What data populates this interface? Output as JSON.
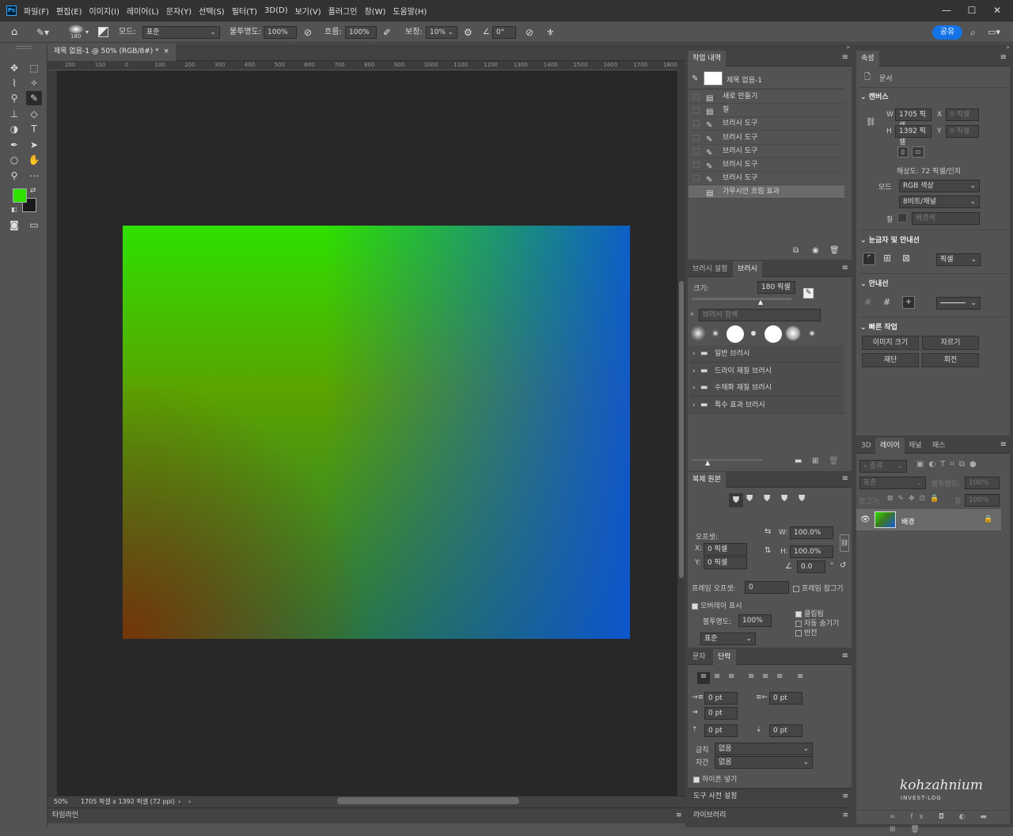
{
  "app": {
    "logo": "Ps"
  },
  "menu": [
    "파일(F)",
    "편집(E)",
    "이미지(I)",
    "레이어(L)",
    "문자(Y)",
    "선택(S)",
    "필터(T)",
    "3D(D)",
    "보기(V)",
    "플러그인",
    "창(W)",
    "도움말(H)"
  ],
  "window_controls": {
    "minimize": "—",
    "maximize": "☐",
    "close": "✕"
  },
  "options": {
    "brush_size": "180",
    "mode_label": "모드:",
    "mode_value": "표준",
    "opacity_label": "불투명도:",
    "opacity_value": "100%",
    "flow_label": "흐름:",
    "flow_value": "100%",
    "smoothing_label": "보정:",
    "smoothing_value": "10%",
    "angle_value": "0°",
    "share_label": "공유"
  },
  "document": {
    "tab_title": "제목 없음-1 @ 50% (RGB/8#) *",
    "zoom": "50%",
    "info": "1705 픽셀 x 1392 픽셀 (72 ppi)",
    "ruler_h": [
      "200",
      "100",
      "0",
      "100",
      "200",
      "300",
      "400",
      "500",
      "600",
      "700",
      "800",
      "900",
      "1000",
      "1100",
      "1200",
      "1300",
      "1400",
      "1500",
      "1600",
      "1700",
      "1800"
    ]
  },
  "timeline_label": "타임라인",
  "colors": {
    "foreground": "#2ee000",
    "background": "#1a1a1a",
    "accent": "#1473e6"
  },
  "history": {
    "tab": "작업 내역",
    "snapshot": "제목 없음-1",
    "items": [
      {
        "label": "새로 만들기",
        "icon": "doc-icon"
      },
      {
        "label": "칠",
        "icon": "doc-icon"
      },
      {
        "label": "브러시 도구",
        "icon": "brush-icon"
      },
      {
        "label": "브러시 도구",
        "icon": "brush-icon"
      },
      {
        "label": "브러시 도구",
        "icon": "brush-icon"
      },
      {
        "label": "브러시 도구",
        "icon": "brush-icon"
      },
      {
        "label": "브러시 도구",
        "icon": "brush-icon"
      },
      {
        "label": "가우시안 흐림 효과",
        "icon": "doc-icon",
        "selected": true
      }
    ]
  },
  "brushes": {
    "tabs": [
      "브러시 설정",
      "브러시"
    ],
    "size_label": "크기:",
    "size_value": "180 픽셀",
    "search_placeholder": "브러시 검색",
    "folders": [
      "일반 브러시",
      "드라이 재질 브러시",
      "수채화 재질 브러시",
      "특수 효과 브러시"
    ]
  },
  "clone_source": {
    "tab": "복제 원본",
    "offset_label": "오프셋:",
    "x_label": "X:",
    "x_value": "0 픽셀",
    "y_label": "Y:",
    "y_value": "0 픽셀",
    "w_label": "W:",
    "w_value": "100.0%",
    "h_label": "H:",
    "h_value": "100.0%",
    "angle_value": "0.0",
    "angle_unit": "°",
    "frame_offset_label": "프레임 오프셋:",
    "frame_offset_value": "0",
    "frame_lock_label": "프레임 잠그기",
    "overlay_label": "오버레이 표시",
    "opacity_label": "불투명도:",
    "opacity_value": "100%",
    "clipped_label": "클립됨",
    "auto_hide_label": "자동 숨기기",
    "invert_label": "반전",
    "blend_value": "표준"
  },
  "paragraph": {
    "tabs": [
      "문자",
      "단락"
    ],
    "indent_left": "0 pt",
    "indent_right": "0 pt",
    "indent_first": "0 pt",
    "space_before": "0 pt",
    "space_after": "0 pt",
    "kinsoku_label": "금칙",
    "kinsoku_value": "없음",
    "mojikumi_label": "자간",
    "mojikumi_value": "없음",
    "hyphenate_label": "하이픈 넣기"
  },
  "tool_presets_label": "도구 사전 설정",
  "libraries_label": "라이브러리",
  "properties": {
    "tab": "속성",
    "doc_label": "문서",
    "canvas_title": "캔버스",
    "w_label": "W",
    "w_value": "1705 픽셀",
    "h_label": "H",
    "h_value": "1392 픽셀",
    "x_label": "X",
    "x_value": "0 픽셀",
    "y_label": "Y",
    "y_value": "0 픽셀",
    "resolution": "해상도: 72 픽셀/인치",
    "mode_label": "모드",
    "mode_value": "RGB 색상",
    "bits_value": "8비트/채널",
    "fill_label": "칠",
    "fill_value": "배경색",
    "rulers_title": "눈금자 및 안내선",
    "ruler_unit": "픽셀",
    "guides_title": "안내선",
    "quick_title": "빠른 작업",
    "quick_buttons": [
      "이미지 크기",
      "자르기",
      "재단",
      "회전"
    ]
  },
  "layers": {
    "tabs": [
      "3D",
      "레이어",
      "채널",
      "패스"
    ],
    "filter_label": "종류",
    "blend_value": "표준",
    "opacity_label": "불투명도:",
    "opacity_value": "100%",
    "lock_label": "잠그기:",
    "fill_label": "칠:",
    "fill_value": "100%",
    "layer_name": "배경"
  },
  "watermark": {
    "line1": "kohzahnium",
    "line2": "INVEST-LOG"
  }
}
